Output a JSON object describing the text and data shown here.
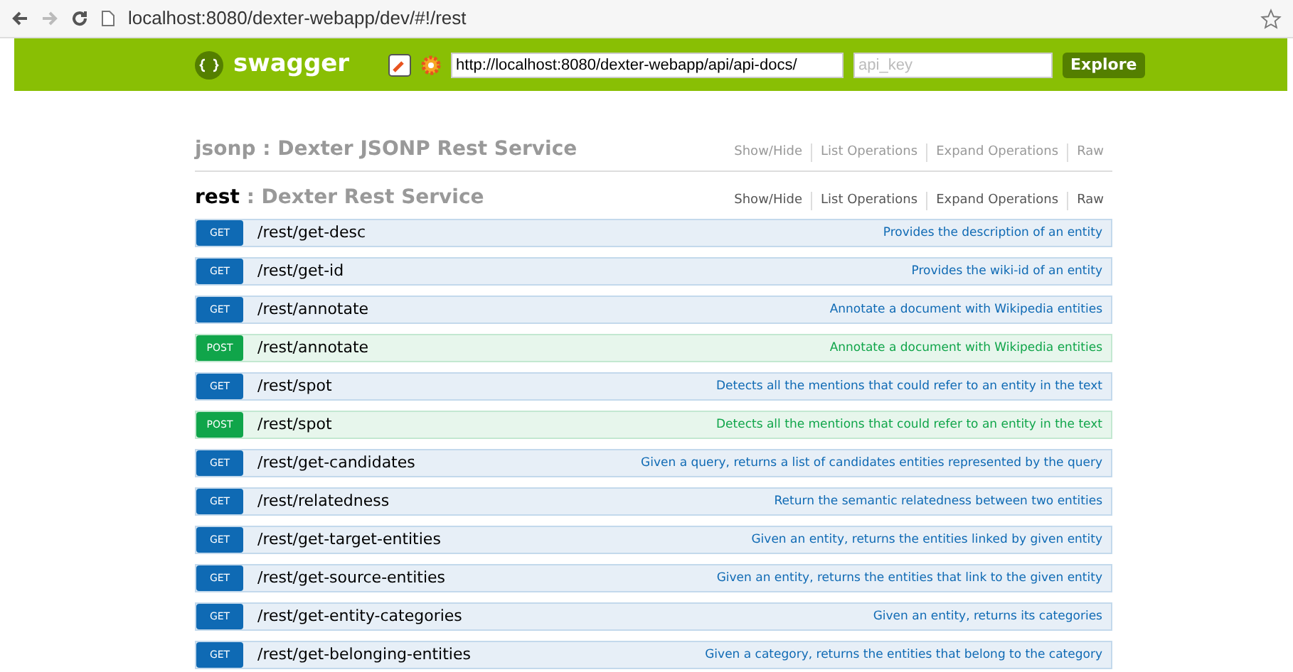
{
  "browser": {
    "url": "localhost:8080/dexter-webapp/dev/#!/rest"
  },
  "header": {
    "brand": "swagger",
    "api_url": "http://localhost:8080/dexter-webapp/api/api-docs/",
    "api_key_placeholder": "api_key",
    "explore_button": "Explore"
  },
  "resources": [
    {
      "name": "jsonp",
      "description": ": Dexter JSONP Rest Service",
      "expanded": false,
      "actions": [
        "Show/Hide",
        "List Operations",
        "Expand Operations",
        "Raw"
      ]
    },
    {
      "name": "rest",
      "description": ": Dexter Rest Service",
      "expanded": true,
      "actions": [
        "Show/Hide",
        "List Operations",
        "Expand Operations",
        "Raw"
      ],
      "operations": [
        {
          "kind": "get",
          "method": "GET",
          "path": "/rest/get-desc",
          "summary": "Provides the description of an entity"
        },
        {
          "kind": "get",
          "method": "GET",
          "path": "/rest/get-id",
          "summary": "Provides the wiki-id of an entity"
        },
        {
          "kind": "get",
          "method": "GET",
          "path": "/rest/annotate",
          "summary": "Annotate a document with Wikipedia entities"
        },
        {
          "kind": "post",
          "method": "POST",
          "path": "/rest/annotate",
          "summary": "Annotate a document with Wikipedia entities"
        },
        {
          "kind": "get",
          "method": "GET",
          "path": "/rest/spot",
          "summary": "Detects all the mentions that could refer to an entity in the text"
        },
        {
          "kind": "post",
          "method": "POST",
          "path": "/rest/spot",
          "summary": "Detects all the mentions that could refer to an entity in the text"
        },
        {
          "kind": "get",
          "method": "GET",
          "path": "/rest/get-candidates",
          "summary": "Given a query, returns a list of candidates entities represented by the query"
        },
        {
          "kind": "get",
          "method": "GET",
          "path": "/rest/relatedness",
          "summary": "Return the semantic relatedness between two entities"
        },
        {
          "kind": "get",
          "method": "GET",
          "path": "/rest/get-target-entities",
          "summary": "Given an entity, returns the entities linked by given entity"
        },
        {
          "kind": "get",
          "method": "GET",
          "path": "/rest/get-source-entities",
          "summary": "Given an entity, returns the entities that link to the given entity"
        },
        {
          "kind": "get",
          "method": "GET",
          "path": "/rest/get-entity-categories",
          "summary": "Given an entity, returns its categories"
        },
        {
          "kind": "get",
          "method": "GET",
          "path": "/rest/get-belonging-entities",
          "summary": "Given a category, returns the entities that belong to the category"
        }
      ]
    }
  ]
}
